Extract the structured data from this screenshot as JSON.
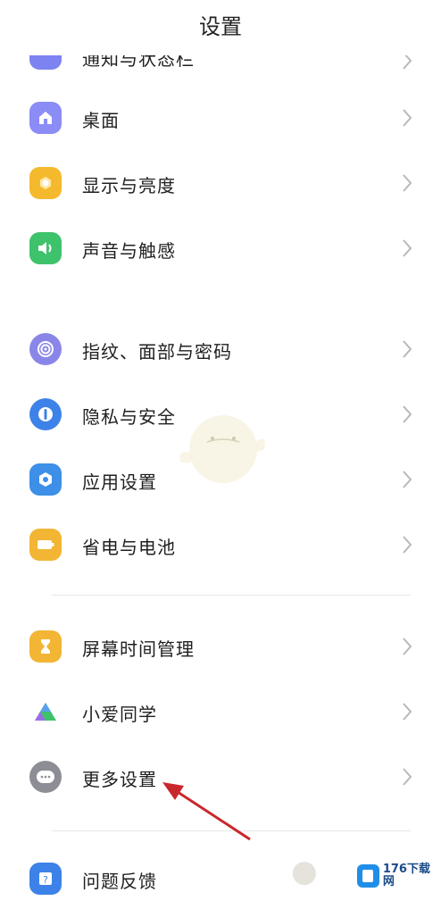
{
  "header": {
    "title": "设置"
  },
  "items": [
    {
      "label": "通知与状态栏",
      "icon": "notification-icon",
      "color": "#7d83f0"
    },
    {
      "label": "桌面",
      "icon": "home-icon",
      "color": "#8b8cf6"
    },
    {
      "label": "显示与亮度",
      "icon": "brightness-icon",
      "color": "#f5b92e"
    },
    {
      "label": "声音与触感",
      "icon": "sound-icon",
      "color": "#3ec26b"
    },
    {
      "label": "指纹、面部与密码",
      "icon": "fingerprint-icon",
      "color": "#8a86e8"
    },
    {
      "label": "隐私与安全",
      "icon": "privacy-icon",
      "color": "#3d82e8"
    },
    {
      "label": "应用设置",
      "icon": "app-settings-icon",
      "color": "#3d8fe8"
    },
    {
      "label": "省电与电池",
      "icon": "battery-icon",
      "color": "#f2b534"
    },
    {
      "label": "屏幕时间管理",
      "icon": "hourglass-icon",
      "color": "#f2b534"
    },
    {
      "label": "小爱同学",
      "icon": "xiaoai-icon",
      "color": "#3ec26b"
    },
    {
      "label": "更多设置",
      "icon": "more-icon",
      "color": "#8d8d96"
    },
    {
      "label": "问题反馈",
      "icon": "feedback-icon",
      "color": "#3d82e8"
    }
  ],
  "watermark": {
    "text": "176下载网"
  }
}
